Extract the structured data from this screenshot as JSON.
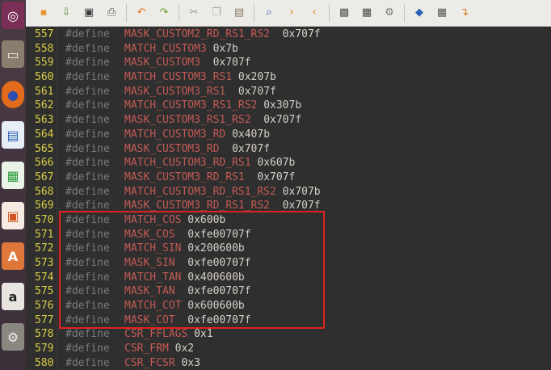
{
  "colors": {
    "line_number": "#d8cd45",
    "keyword": "#7c7a7a",
    "macro_name": "#c45a55",
    "value": "#d6d1c7",
    "highlight_box": "#e02222",
    "editor_bg": "#2f2f2f"
  },
  "launcher": {
    "items": [
      {
        "icon": "ubuntu-dash-icon"
      },
      {
        "icon": "files-icon"
      },
      {
        "icon": "firefox-icon"
      },
      {
        "icon": "writer-document-icon"
      },
      {
        "icon": "calc-spreadsheet-icon"
      },
      {
        "icon": "impress-presentation-icon"
      },
      {
        "icon": "software-center-icon"
      },
      {
        "icon": "amazon-icon"
      },
      {
        "icon": "system-settings-icon"
      }
    ]
  },
  "toolbar": {
    "buttons": [
      {
        "icon": "new-file-icon"
      },
      {
        "icon": "open-file-icon"
      },
      {
        "icon": "save-icon"
      },
      {
        "icon": "print-icon"
      },
      {
        "icon": "undo-icon"
      },
      {
        "icon": "redo-icon"
      },
      {
        "icon": "cut-icon"
      },
      {
        "icon": "copy-icon"
      },
      {
        "icon": "paste-icon"
      },
      {
        "icon": "find-icon"
      },
      {
        "icon": "find-next-icon"
      },
      {
        "icon": "find-previous-icon"
      },
      {
        "icon": "screenshot-icon"
      },
      {
        "icon": "preferences-icon"
      },
      {
        "icon": "tools-icon"
      },
      {
        "icon": "spellcheck-icon"
      },
      {
        "icon": "table-icon"
      },
      {
        "icon": "jump-icon"
      }
    ]
  },
  "editor": {
    "keyword": "#define",
    "lines": [
      {
        "num": "557",
        "name": "MASK_CUSTOM2_RD_RS1_RS2",
        "gap": "  ",
        "value": "0x707f"
      },
      {
        "num": "558",
        "name": "MATCH_CUSTOM3",
        "gap": " ",
        "value": "0x7b"
      },
      {
        "num": "559",
        "name": "MASK_CUSTOM3",
        "gap": "  ",
        "value": "0x707f"
      },
      {
        "num": "560",
        "name": "MATCH_CUSTOM3_RS1",
        "gap": " ",
        "value": "0x207b"
      },
      {
        "num": "561",
        "name": "MASK_CUSTOM3_RS1",
        "gap": "  ",
        "value": "0x707f"
      },
      {
        "num": "562",
        "name": "MATCH_CUSTOM3_RS1_RS2",
        "gap": " ",
        "value": "0x307b"
      },
      {
        "num": "563",
        "name": "MASK_CUSTOM3_RS1_RS2",
        "gap": "  ",
        "value": "0x707f"
      },
      {
        "num": "564",
        "name": "MATCH_CUSTOM3_RD",
        "gap": " ",
        "value": "0x407b"
      },
      {
        "num": "565",
        "name": "MASK_CUSTOM3_RD",
        "gap": "  ",
        "value": "0x707f"
      },
      {
        "num": "566",
        "name": "MATCH_CUSTOM3_RD_RS1",
        "gap": " ",
        "value": "0x607b"
      },
      {
        "num": "567",
        "name": "MASK_CUSTOM3_RD_RS1",
        "gap": "  ",
        "value": "0x707f"
      },
      {
        "num": "568",
        "name": "MATCH_CUSTOM3_RD_RS1_RS2",
        "gap": " ",
        "value": "0x707b"
      },
      {
        "num": "569",
        "name": "MASK_CUSTOM3_RD_RS1_RS2",
        "gap": "  ",
        "value": "0x707f"
      },
      {
        "num": "570",
        "name": "MATCH_COS",
        "gap": " ",
        "value": "0x600b"
      },
      {
        "num": "571",
        "name": "MASK_COS",
        "gap": "  ",
        "value": "0xfe00707f"
      },
      {
        "num": "572",
        "name": "MATCH_SIN",
        "gap": " ",
        "value": "0x200600b"
      },
      {
        "num": "573",
        "name": "MASK_SIN",
        "gap": "  ",
        "value": "0xfe00707f"
      },
      {
        "num": "574",
        "name": "MATCH_TAN",
        "gap": " ",
        "value": "0x400600b"
      },
      {
        "num": "575",
        "name": "MASK_TAN",
        "gap": "  ",
        "value": "0xfe00707f"
      },
      {
        "num": "576",
        "name": "MATCH_COT",
        "gap": " ",
        "value": "0x600600b"
      },
      {
        "num": "577",
        "name": "MASK_COT",
        "gap": "  ",
        "value": "0xfe00707f"
      },
      {
        "num": "578",
        "name": "CSR_FFLAGS",
        "gap": " ",
        "value": "0x1"
      },
      {
        "num": "579",
        "name": "CSR_FRM",
        "gap": " ",
        "value": "0x2"
      },
      {
        "num": "580",
        "name": "CSR_FCSR",
        "gap": " ",
        "value": "0x3"
      }
    ]
  }
}
